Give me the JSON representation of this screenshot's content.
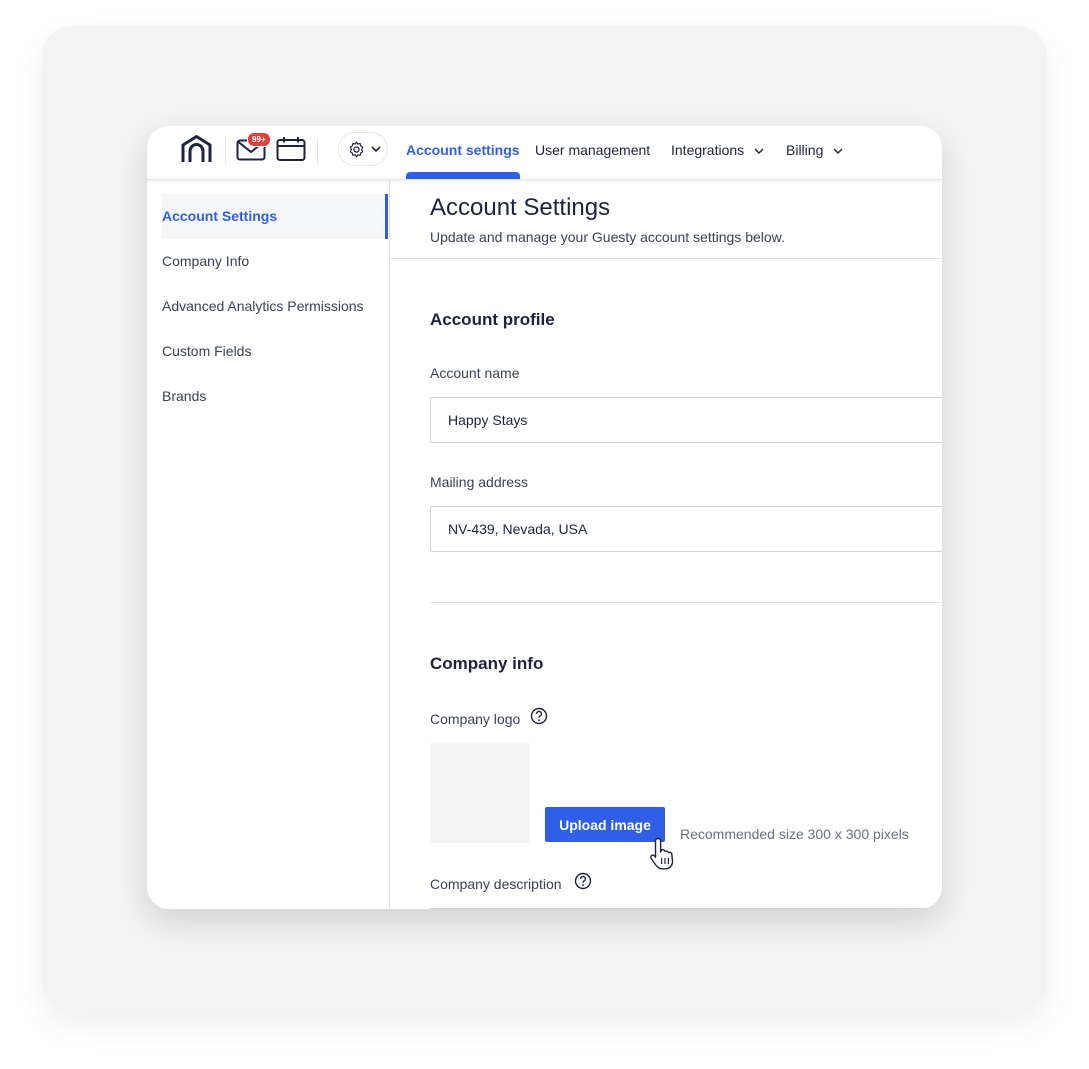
{
  "nav": {
    "badge_count": "99+",
    "tabs": [
      {
        "label": "Account settings"
      },
      {
        "label": "User management"
      },
      {
        "label": "Integrations"
      },
      {
        "label": "Billing"
      }
    ]
  },
  "sidebar": {
    "items": [
      {
        "label": "Account Settings"
      },
      {
        "label": "Company Info"
      },
      {
        "label": "Advanced Analytics Permissions"
      },
      {
        "label": "Custom Fields"
      },
      {
        "label": "Brands"
      }
    ]
  },
  "main": {
    "title": "Account Settings",
    "subtitle": "Update and manage your Guesty account settings below.",
    "account_profile": {
      "heading": "Account profile",
      "account_name_label": "Account name",
      "account_name_value": "Happy Stays",
      "mailing_address_label": "Mailing address",
      "mailing_address_value": "NV-439, Nevada, USA"
    },
    "company_info": {
      "heading": "Company info",
      "logo_label": "Company logo",
      "upload_button": "Upload image",
      "recommended_size": "Recommended size 300 x 300 pixels",
      "description_label": "Company description"
    }
  },
  "colors": {
    "accent": "#2f5fe6",
    "badge": "#e0403a",
    "text_primary": "#1c2340",
    "text_secondary": "#3a405a"
  },
  "icons": [
    "home-icon",
    "mail-icon",
    "calendar-icon",
    "gear-icon",
    "chevron-down-icon",
    "help-icon",
    "hand-pointer-cursor-icon"
  ]
}
